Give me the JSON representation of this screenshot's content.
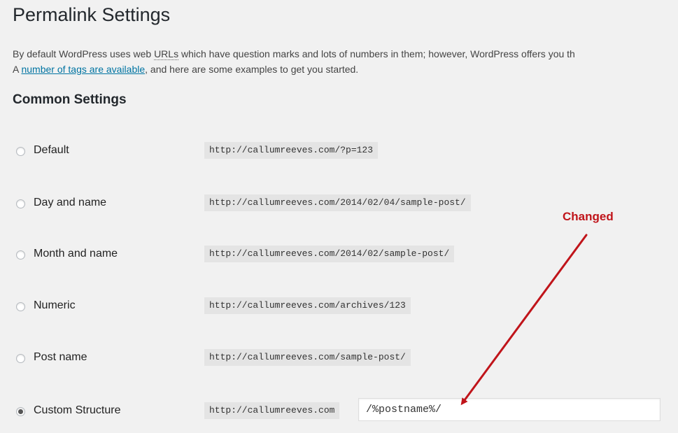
{
  "page": {
    "title": "Permalink Settings",
    "intro_line1": "By default WordPress uses web URLs which have question marks and lots of numbers in them; however, WordPress offers you th",
    "intro_line1_prefix": "By default WordPress uses web ",
    "intro_line1_abbr": "URLs",
    "intro_line1_suffix": " which have question marks and lots of numbers in them; however, WordPress offers you th",
    "intro_line2_prefix": "A ",
    "intro_link": "number of tags are available",
    "intro_line2_suffix": ", and here are some examples to get you started."
  },
  "common": {
    "heading": "Common Settings",
    "options": [
      {
        "label": "Default",
        "example": "http://callumreeves.com/?p=123",
        "selected": false
      },
      {
        "label": "Day and name",
        "example": "http://callumreeves.com/2014/02/04/sample-post/",
        "selected": false
      },
      {
        "label": "Month and name",
        "example": "http://callumreeves.com/2014/02/sample-post/",
        "selected": false
      },
      {
        "label": "Numeric",
        "example": "http://callumreeves.com/archives/123",
        "selected": false
      },
      {
        "label": "Post name",
        "example": "http://callumreeves.com/sample-post/",
        "selected": false
      },
      {
        "label": "Custom Structure",
        "example": "http://callumreeves.com",
        "value": "/%postname%/",
        "selected": true
      }
    ]
  },
  "annotation": {
    "text": "Changed",
    "color": "#c0141a"
  }
}
